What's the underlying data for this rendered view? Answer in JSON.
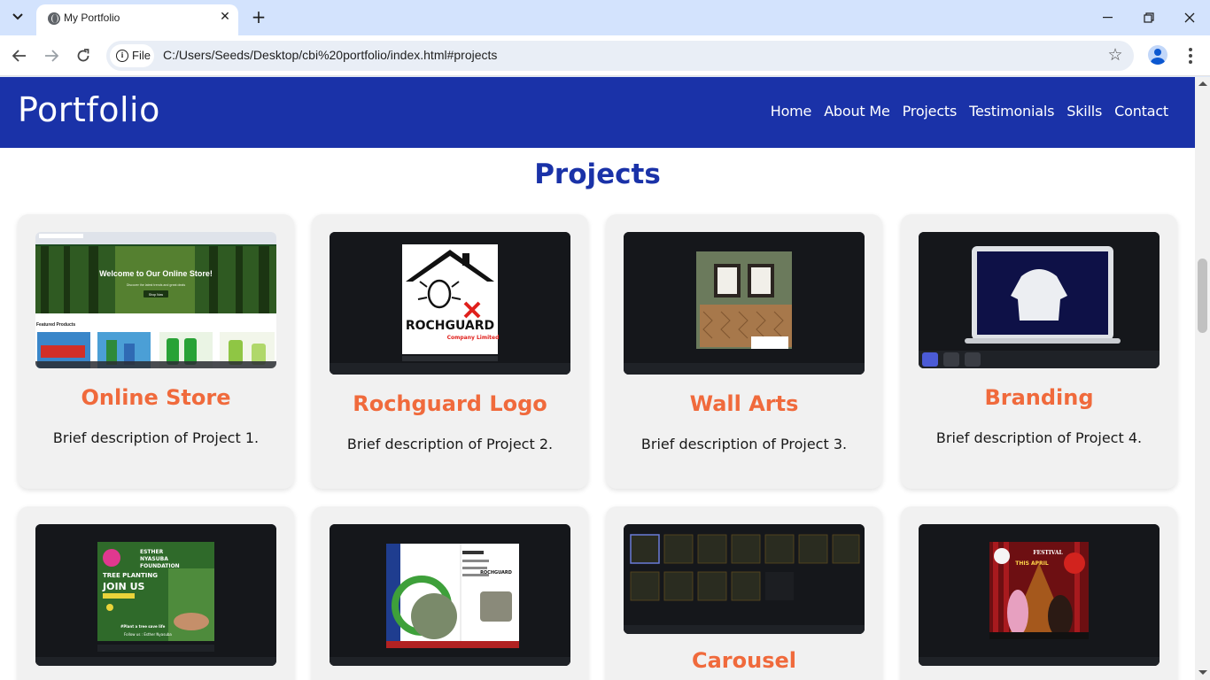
{
  "browser": {
    "tab_title": "My Portfolio",
    "file_label": "File",
    "url": "C:/Users/Seeds/Desktop/cbi%20portfolio/index.html#projects",
    "icons": [
      "tab-search-icon",
      "globe-icon",
      "close-icon",
      "plus-icon",
      "minimize-icon",
      "restore-icon",
      "close-window-icon",
      "back-arrow-icon",
      "forward-arrow-icon",
      "reload-icon",
      "info-icon",
      "star-icon",
      "profile-icon",
      "kebab-menu-icon"
    ]
  },
  "site": {
    "logo": "Portfolio",
    "nav": [
      "Home",
      "About Me",
      "Projects",
      "Testimonials",
      "Skills",
      "Contact"
    ],
    "section_title": "Projects",
    "colors": {
      "header": "#1a32a8",
      "accent": "#f06a3c",
      "card": "#f1f1f1"
    }
  },
  "projects": [
    {
      "title": "Online Store",
      "desc": "Brief description of Project 1.",
      "thumb": {
        "banner": "Welcome to Our Online Store!",
        "sub": "Discover the latest trends and great deals",
        "button": "Shop Now",
        "featured": "Featured Products"
      }
    },
    {
      "title": "Rochguard Logo",
      "desc": "Brief description of Project 2.",
      "thumb": {
        "brand": "ROCHGUARD",
        "tagline": "Company Limited"
      }
    },
    {
      "title": "Wall Arts",
      "desc": "Brief description of Project 3.",
      "thumb": {}
    },
    {
      "title": "Branding",
      "desc": "Brief description of Project 4.",
      "thumb": {}
    },
    {
      "title": "",
      "desc": "",
      "thumb": {
        "line1": "ESTHER",
        "line2": "NYASUBA",
        "line3": "FOUNDATION",
        "line4": "TREE PLANTING",
        "line5": "JOIN US",
        "line6": "#Plant a tree save life",
        "line7": "Follow us : Esther Nyasuba"
      }
    },
    {
      "title": "",
      "desc": "",
      "thumb": {
        "brand": "ROCHGUARD"
      }
    },
    {
      "title": "Carousel",
      "desc": "",
      "thumb": {}
    },
    {
      "title": "",
      "desc": "",
      "thumb": {
        "event": "THIS APRIL",
        "header": "FESTIVAL"
      }
    }
  ]
}
